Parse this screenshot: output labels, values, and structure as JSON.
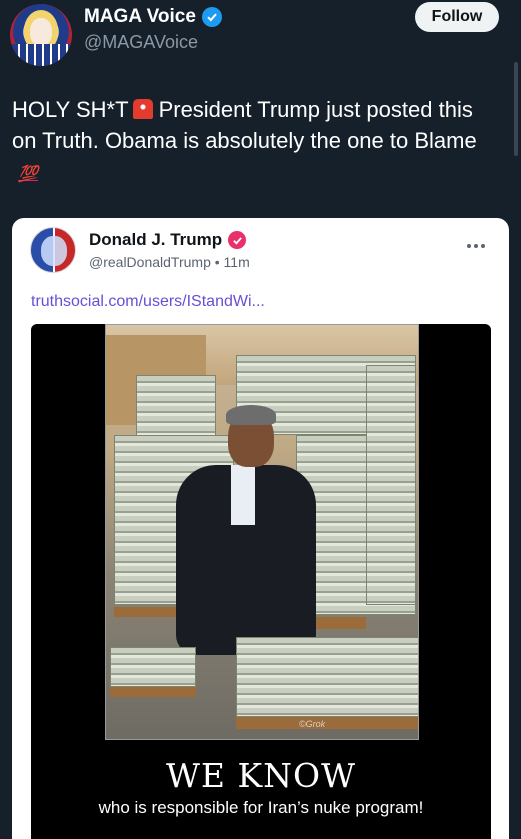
{
  "tweet": {
    "account_name": "MAGA Voice",
    "handle": "@MAGAVoice",
    "follow_label": "Follow",
    "text_part1": "HOLY SH*T",
    "text_part2": "President Trump just posted this on Truth. Obama is absolutely the one to Blame",
    "emoji_siren": "police-siren-icon",
    "emoji_hundred": "💯"
  },
  "embedded_post": {
    "author_name": "Donald J. Trump",
    "author_handle": "@realDonaldTrump",
    "separator": "•",
    "time": "11m",
    "link_text": "truthsocial.com/users/IStandWi...",
    "more_icon": "ellipsis-icon"
  },
  "poster": {
    "title": "WE KNOW",
    "subtitle": "who is responsible for Iran’s nuke program!",
    "watermark": "©Grok"
  },
  "colors": {
    "background": "#15202b",
    "verified": "#1d9bf0",
    "truth_badge": "#e8306a",
    "link": "#6a4ed6"
  }
}
